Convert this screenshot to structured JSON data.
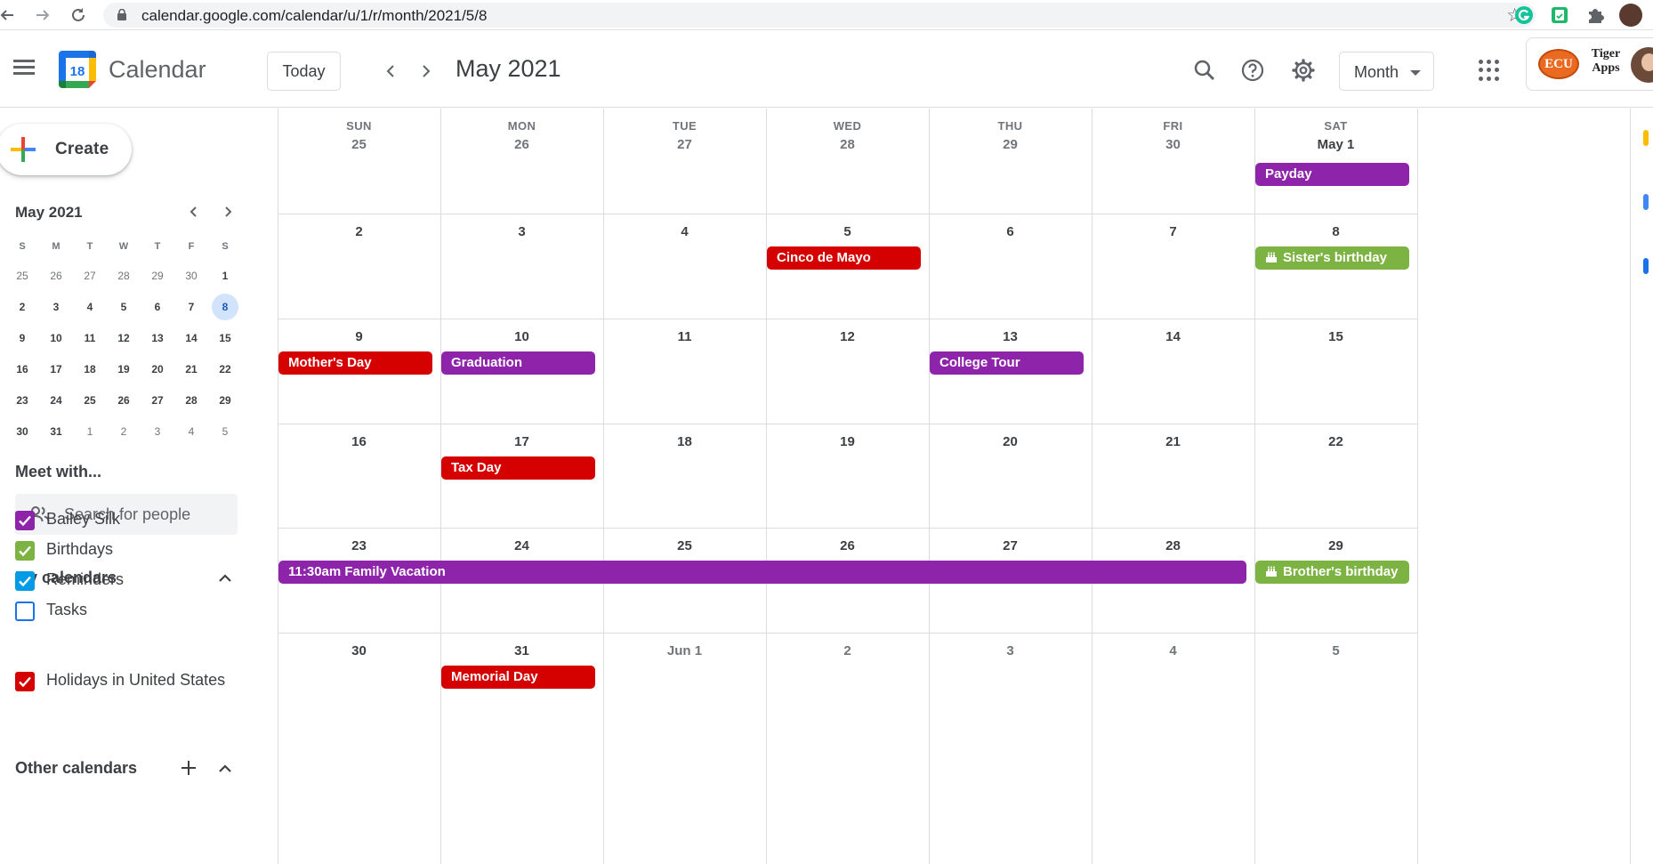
{
  "browser": {
    "url": "calendar.google.com/calendar/u/1/r/month/2021/5/8"
  },
  "header": {
    "app_name": "Calendar",
    "logo_day": "18",
    "today_label": "Today",
    "month_title": "May 2021",
    "view_label": "Month",
    "org_logo_text": "ECU",
    "org_name": "Tiger Apps"
  },
  "sidebar": {
    "create_label": "Create",
    "mini_title": "May 2021",
    "weekday_initials": [
      "S",
      "M",
      "T",
      "W",
      "T",
      "F",
      "S"
    ],
    "mini_weeks": [
      [
        "25",
        "26",
        "27",
        "28",
        "29",
        "30",
        "1"
      ],
      [
        "2",
        "3",
        "4",
        "5",
        "6",
        "7",
        "8"
      ],
      [
        "9",
        "10",
        "11",
        "12",
        "13",
        "14",
        "15"
      ],
      [
        "16",
        "17",
        "18",
        "19",
        "20",
        "21",
        "22"
      ],
      [
        "23",
        "24",
        "25",
        "26",
        "27",
        "28",
        "29"
      ],
      [
        "30",
        "31",
        "1",
        "2",
        "3",
        "4",
        "5"
      ]
    ],
    "meet_title": "Meet with...",
    "search_placeholder": "Search for people",
    "my_calendars_title": "My calendars",
    "my_calendars": [
      {
        "label": "Bailey Silk",
        "color": "#8e24aa",
        "checked": true
      },
      {
        "label": "Birthdays",
        "color": "#7cb342",
        "checked": true
      },
      {
        "label": "Reminders",
        "color": "#039be5",
        "checked": true
      },
      {
        "label": "Tasks",
        "color": "#1a73e8",
        "checked": false
      }
    ],
    "other_calendars_title": "Other calendars",
    "other_calendars": [
      {
        "label": "Holidays in United States",
        "color": "#d50000",
        "checked": true
      }
    ]
  },
  "grid": {
    "weekdays": [
      "SUN",
      "MON",
      "TUE",
      "WED",
      "THU",
      "FRI",
      "SAT"
    ],
    "weeks": [
      [
        "25",
        "26",
        "27",
        "28",
        "29",
        "30",
        "May 1"
      ],
      [
        "2",
        "3",
        "4",
        "5",
        "6",
        "7",
        "8"
      ],
      [
        "9",
        "10",
        "11",
        "12",
        "13",
        "14",
        "15"
      ],
      [
        "16",
        "17",
        "18",
        "19",
        "20",
        "21",
        "22"
      ],
      [
        "23",
        "24",
        "25",
        "26",
        "27",
        "28",
        "29"
      ],
      [
        "30",
        "31",
        "Jun 1",
        "2",
        "3",
        "4",
        "5"
      ]
    ],
    "events": [
      {
        "title": "Payday",
        "week": 0,
        "day": 6,
        "span": 1,
        "color": "#8e24aa",
        "birthday": false
      },
      {
        "title": "Cinco de Mayo",
        "week": 1,
        "day": 3,
        "span": 1,
        "color": "#d50000",
        "birthday": false
      },
      {
        "title": "Sister's birthday",
        "week": 1,
        "day": 6,
        "span": 1,
        "color": "#7cb342",
        "birthday": true
      },
      {
        "title": "Mother's Day",
        "week": 2,
        "day": 0,
        "span": 1,
        "color": "#d50000",
        "birthday": false
      },
      {
        "title": "Graduation",
        "week": 2,
        "day": 1,
        "span": 1,
        "color": "#8e24aa",
        "birthday": false
      },
      {
        "title": "College Tour",
        "week": 2,
        "day": 4,
        "span": 1,
        "color": "#8e24aa",
        "birthday": false
      },
      {
        "title": "Tax Day",
        "week": 3,
        "day": 1,
        "span": 1,
        "color": "#d50000",
        "birthday": false
      },
      {
        "title": "11:30am Family Vacation",
        "week": 4,
        "day": 0,
        "span": 6,
        "color": "#8e24aa",
        "birthday": false
      },
      {
        "title": "Brother's birthday",
        "week": 4,
        "day": 6,
        "span": 1,
        "color": "#7cb342",
        "birthday": true
      },
      {
        "title": "Memorial Day",
        "week": 5,
        "day": 1,
        "span": 1,
        "color": "#d50000",
        "birthday": false
      }
    ]
  },
  "icons": {
    "back": "back-arrow-icon",
    "forward": "forward-arrow-icon",
    "reload": "reload-icon",
    "lock": "lock-icon",
    "bookmark": "star-icon",
    "search": "search-icon",
    "help": "help-icon",
    "settings": "gear-icon",
    "apps": "apps-grid-icon"
  }
}
